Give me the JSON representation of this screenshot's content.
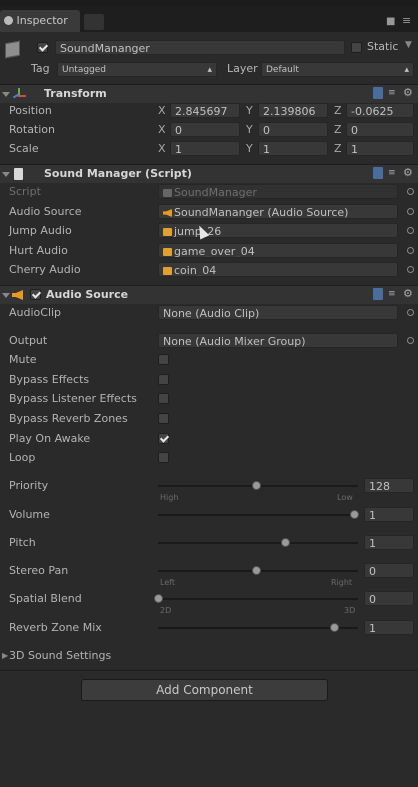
{
  "window": {
    "tab_label": "Inspector"
  },
  "object": {
    "name": "SoundMananger",
    "active": true,
    "static_label": "Static",
    "static_checked": false,
    "tag_label": "Tag",
    "tag_value": "Untagged",
    "layer_label": "Layer",
    "layer_value": "Default"
  },
  "transform": {
    "title": "Transform",
    "rows": [
      {
        "label": "Position",
        "x": "2.845697",
        "y": "2.139806",
        "z": "-0.0625"
      },
      {
        "label": "Rotation",
        "x": "0",
        "y": "0",
        "z": "0"
      },
      {
        "label": "Scale",
        "x": "1",
        "y": "1",
        "z": "1"
      }
    ],
    "axis": {
      "x": "X",
      "y": "Y",
      "z": "Z"
    }
  },
  "sound_manager": {
    "title": "Sound Manager (Script)",
    "script_label": "Script",
    "script_value": "SoundManager",
    "fields": [
      {
        "label": "Audio Source",
        "value": "SoundMananger (Audio Source)"
      },
      {
        "label": "Jump Audio",
        "value": "jump_26"
      },
      {
        "label": "Hurt Audio",
        "value": "game_over_04"
      },
      {
        "label": "Cherry Audio",
        "value": "coin_04"
      }
    ]
  },
  "audio_source": {
    "title": "Audio Source",
    "enabled": true,
    "audio_clip_label": "AudioClip",
    "audio_clip_value": "None (Audio Clip)",
    "output_label": "Output",
    "output_value": "None (Audio Mixer Group)",
    "toggles": [
      {
        "label": "Mute",
        "checked": false
      },
      {
        "label": "Bypass Effects",
        "checked": false
      },
      {
        "label": "Bypass Listener Effects",
        "checked": false
      },
      {
        "label": "Bypass Reverb Zones",
        "checked": false
      },
      {
        "label": "Play On Awake",
        "checked": true
      },
      {
        "label": "Loop",
        "checked": false
      }
    ],
    "sliders": [
      {
        "label": "Priority",
        "value": "128",
        "fraction": 0.5,
        "min_label": "High",
        "max_label": "Low"
      },
      {
        "label": "Volume",
        "value": "1",
        "fraction": 1.0
      },
      {
        "label": "Pitch",
        "value": "1",
        "fraction": 0.65
      },
      {
        "label": "Stereo Pan",
        "value": "0",
        "fraction": 0.5,
        "min_label": "Left",
        "max_label": "Right"
      },
      {
        "label": "Spatial Blend",
        "value": "0",
        "fraction": 0.0,
        "min_label": "2D",
        "max_label": "3D"
      },
      {
        "label": "Reverb Zone Mix",
        "value": "1",
        "fraction": 0.9
      }
    ],
    "settings_3d_label": "3D Sound Settings"
  },
  "add_component_label": "Add Component"
}
